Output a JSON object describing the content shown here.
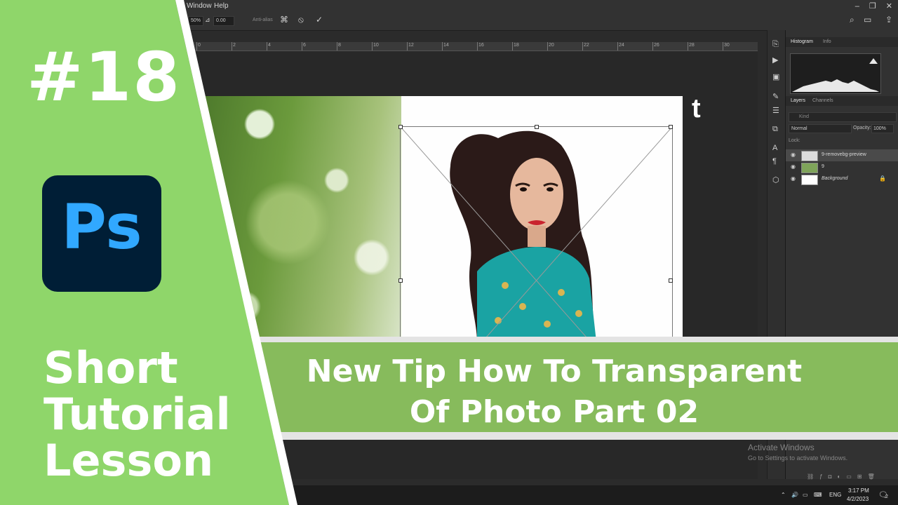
{
  "menubar": {
    "items": [
      "Window",
      "Help"
    ]
  },
  "options_bar": {
    "zoom_value": "50%",
    "angle_value": "0.00",
    "antialias_label": "Anti-alias",
    "icons": [
      "warp-icon",
      "cancel-icon",
      "commit-icon",
      "search-icon",
      "workspace-icon",
      "share-icon"
    ]
  },
  "ruler": {
    "labels": [
      "0",
      "2",
      "4",
      "6",
      "8",
      "10",
      "12",
      "14",
      "16",
      "18",
      "20",
      "22",
      "24",
      "26",
      "28",
      "30"
    ]
  },
  "document": {
    "overlay_letter": "t"
  },
  "panels": {
    "top_tabs": {
      "active": "Histogram",
      "other": "Info"
    },
    "layer_tabs": {
      "active": "Layers",
      "other": "Channels"
    },
    "kind_label": "Kind",
    "blend_mode": "Normal",
    "opacity_label": "Opacity:",
    "opacity_value": "100%",
    "lock_label": "Lock:",
    "layers": [
      {
        "name": "9-removebg-preview",
        "locked": false
      },
      {
        "name": "9",
        "locked": false
      },
      {
        "name": "Background",
        "locked": true
      }
    ]
  },
  "watermark": {
    "line1": "Activate Windows",
    "line2": "Go to Settings to activate Windows."
  },
  "taskbar": {
    "lang": "ENG",
    "time": "3:17 PM",
    "date": "4/2/2023",
    "notif_count": "2"
  },
  "thumbnail": {
    "episode": "#18",
    "logo_text": "Ps",
    "side_title_lines": [
      "Short",
      "Tutorial",
      "Lesson"
    ],
    "banner_lines": [
      "New Tip How To Transparent",
      "Of Photo Part 02"
    ],
    "colors": {
      "green": "#8fd66a",
      "banner": "#78b446",
      "ps_bg": "#001e36",
      "ps_text": "#31a8ff"
    }
  }
}
